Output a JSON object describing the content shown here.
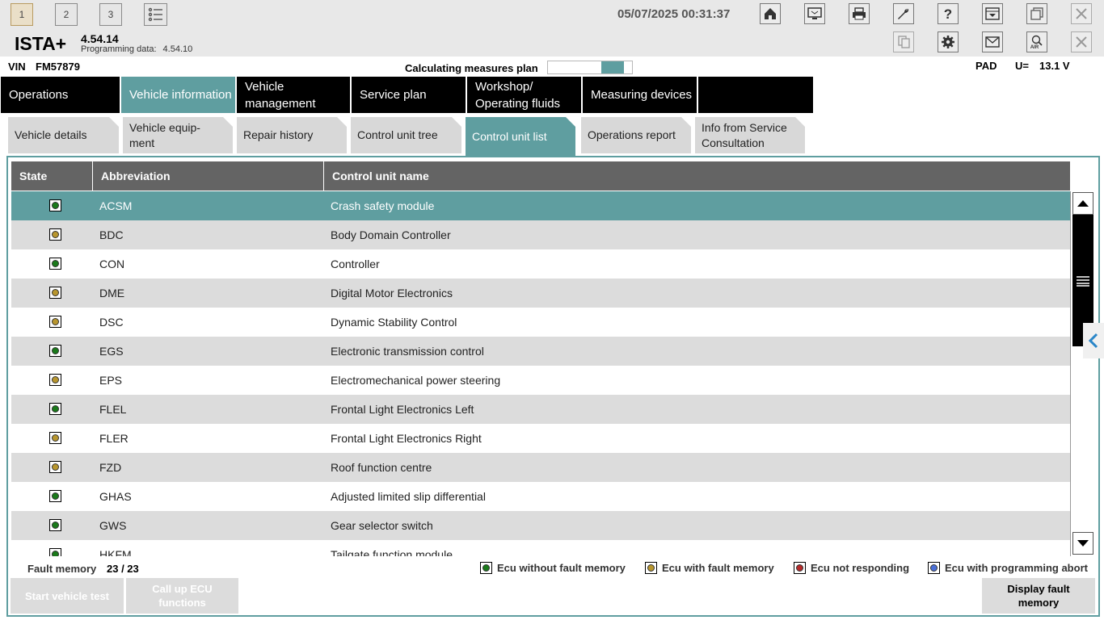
{
  "topbar": {
    "window_buttons": [
      "1",
      "2",
      "3"
    ],
    "datetime": "05/07/2025 00:31:37",
    "icons": [
      "list-icon",
      "home-icon",
      "display-switch-icon",
      "print-icon",
      "wrench-icon",
      "help-icon",
      "download-icon",
      "window-icon",
      "close-icon"
    ]
  },
  "app": {
    "name": "ISTA+",
    "version": "4.54.14",
    "programming_label": "Programming data:",
    "programming_version": "4.54.10",
    "header_icons": [
      "documents-icon",
      "gear-icon",
      "mail-icon",
      "air-search-icon",
      "close-icon"
    ]
  },
  "vehicle": {
    "vin_label": "VIN",
    "vin": "FM57879",
    "calc_label": "Calculating measures plan",
    "calc_progress": 0.27,
    "pad_label": "PAD",
    "voltage_label": "U=",
    "voltage": "13.1 V"
  },
  "nav": {
    "tabs": [
      {
        "label": "Operations"
      },
      {
        "label": "Vehicle information"
      },
      {
        "label": "Vehicle management"
      },
      {
        "label": "Service plan"
      },
      {
        "label": "Workshop/ Operating fluids"
      },
      {
        "label": "Measuring devices"
      }
    ],
    "active": "Vehicle information"
  },
  "subtabs": {
    "tabs": [
      {
        "label": "Vehicle details"
      },
      {
        "label": "Vehicle equip-ment"
      },
      {
        "label": "Repair history"
      },
      {
        "label": "Control unit tree"
      },
      {
        "label": "Control unit list"
      },
      {
        "label": "Operations report"
      },
      {
        "label": "Info from Service Consultation"
      }
    ],
    "active": "Control unit list"
  },
  "table": {
    "headers": {
      "state": "State",
      "abbreviation": "Abbreviation",
      "name": "Control unit name"
    },
    "rows": [
      {
        "state": "ok",
        "abbr": "ACSM",
        "name": "Crash safety module"
      },
      {
        "state": "fault",
        "abbr": "BDC",
        "name": "Body Domain Controller"
      },
      {
        "state": "ok",
        "abbr": "CON",
        "name": "Controller"
      },
      {
        "state": "fault",
        "abbr": "DME",
        "name": "Digital Motor Electronics"
      },
      {
        "state": "fault",
        "abbr": "DSC",
        "name": "Dynamic Stability Control"
      },
      {
        "state": "ok",
        "abbr": "EGS",
        "name": "Electronic transmission control"
      },
      {
        "state": "fault",
        "abbr": "EPS",
        "name": "Electromechanical power steering"
      },
      {
        "state": "ok",
        "abbr": "FLEL",
        "name": "Frontal Light Electronics Left"
      },
      {
        "state": "fault",
        "abbr": "FLER",
        "name": "Frontal Light Electronics Right"
      },
      {
        "state": "fault",
        "abbr": "FZD",
        "name": "Roof function centre"
      },
      {
        "state": "ok",
        "abbr": "GHAS",
        "name": "Adjusted limited slip differential"
      },
      {
        "state": "ok",
        "abbr": "GWS",
        "name": "Gear selector switch"
      },
      {
        "state": "ok",
        "abbr": "HKFM",
        "name": "Tailgate function module"
      }
    ]
  },
  "colors": {
    "accent": "#5f9ea0",
    "ok": "#1a7a1a",
    "fault": "#b8962e",
    "not_responding": "#b52a2a",
    "programming_abort": "#4a6fd8"
  },
  "footer": {
    "fault_memory_label": "Fault memory",
    "fault_memory_value": "23 / 23",
    "legend": [
      {
        "key": "ok",
        "label": "Ecu without fault memory"
      },
      {
        "key": "fault",
        "label": "Ecu with fault memory"
      },
      {
        "key": "not_responding",
        "label": "Ecu not responding"
      },
      {
        "key": "programming_abort",
        "label": "Ecu with programming abort"
      }
    ],
    "buttons": {
      "start_test": "Start vehicle test",
      "call_ecu": "Call up ECU functions",
      "display_fault": "Display fault memory"
    }
  }
}
